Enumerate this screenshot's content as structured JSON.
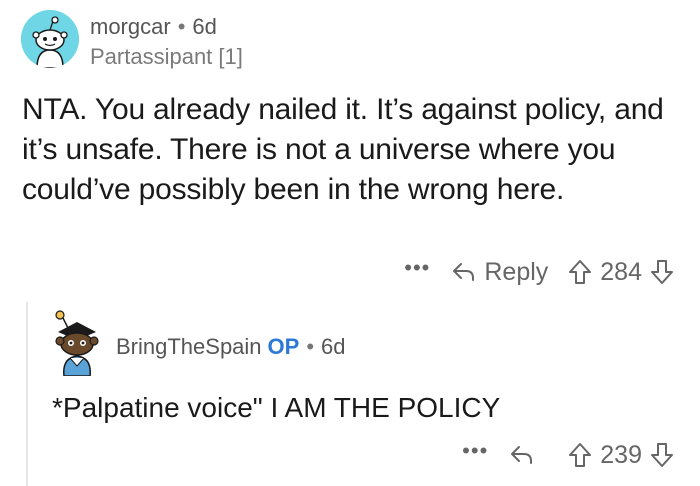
{
  "comment": {
    "username": "morgcar",
    "separator": "•",
    "age": "6d",
    "flair": "Partassipant [1]",
    "body": "NTA. You already nailed it. It’s against policy, and it’s unsafe. There is not a universe where you could’ve possibly been in the wrong here.",
    "more_label": "•••",
    "reply_label": "Reply",
    "score": "284",
    "avatar_icon": "reddit-snoo-icon",
    "colors": {
      "avatar_bg": "#6fd6e6",
      "username": "#555555",
      "meta": "#7a7a7a",
      "text": "#1a1a1b"
    }
  },
  "reply": {
    "username": "BringTheSpain",
    "op_badge": "OP",
    "separator": "•",
    "age": "6d",
    "body": "*Palpatine voice\" I AM THE POLICY",
    "more_label": "•••",
    "score": "239",
    "avatar_icon": "snoo-avatar-with-hat-icon",
    "colors": {
      "op_badge": "#2c7ad6"
    }
  }
}
